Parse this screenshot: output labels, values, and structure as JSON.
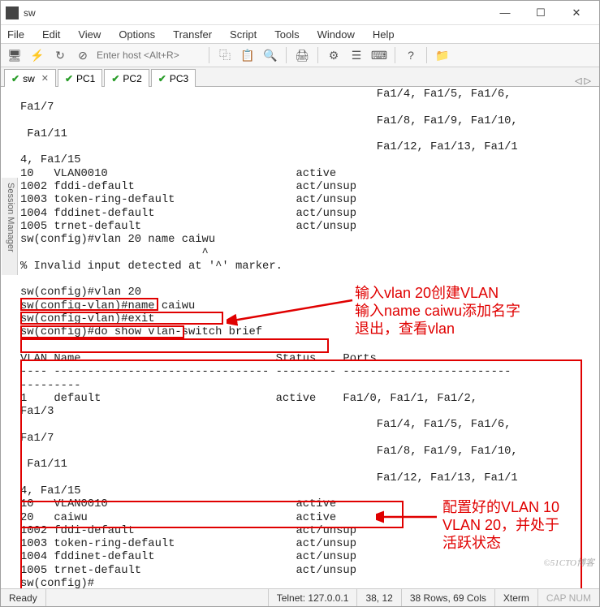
{
  "window": {
    "title": "sw"
  },
  "menu": {
    "file": "File",
    "edit": "Edit",
    "view": "View",
    "options": "Options",
    "transfer": "Transfer",
    "script": "Script",
    "tools": "Tools",
    "window": "Window",
    "help": "Help"
  },
  "toolbar": {
    "host_placeholder": "Enter host <Alt+R>"
  },
  "side_tab": "Session Manager",
  "tabs": {
    "t0": {
      "label": "sw"
    },
    "t1": {
      "label": "PC1"
    },
    "t2": {
      "label": "PC2"
    },
    "t3": {
      "label": "PC3"
    },
    "nav": "◁  ▷"
  },
  "terminal": "                                                     Fa1/4, Fa1/5, Fa1/6,\nFa1/7\n                                                     Fa1/8, Fa1/9, Fa1/10,\n Fa1/11\n                                                     Fa1/12, Fa1/13, Fa1/1\n4, Fa1/15\n10   VLAN0010                            active\n1002 fddi-default                        act/unsup\n1003 token-ring-default                  act/unsup\n1004 fddinet-default                     act/unsup\n1005 trnet-default                       act/unsup\nsw(config)#vlan 20 name caiwu\n                           ^\n% Invalid input detected at '^' marker.\n\nsw(config)#vlan 20\nsw(config-vlan)#name caiwu\nsw(config-vlan)#exit\nsw(config)#do show vlan-switch brief\n\nVLAN Name                             Status    Ports\n---- -------------------------------- --------- -------------------------\n---------\n1    default                          active    Fa1/0, Fa1/1, Fa1/2,\nFa1/3\n                                                     Fa1/4, Fa1/5, Fa1/6,\nFa1/7\n                                                     Fa1/8, Fa1/9, Fa1/10,\n Fa1/11\n                                                     Fa1/12, Fa1/13, Fa1/1\n4, Fa1/15\n10   VLAN0010                            active\n20   caiwu                               active\n1002 fddi-default                        act/unsup\n1003 token-ring-default                  act/unsup\n1004 fddinet-default                     act/unsup\n1005 trnet-default                       act/unsup\nsw(config)#",
  "status": {
    "ready": "Ready",
    "conn": "Telnet: 127.0.0.1",
    "pos": "38, 12",
    "size": "38 Rows, 69 Cols",
    "term": "Xterm",
    "caps": "CAP  NUM"
  },
  "annotations": {
    "note1_l1": "输入vlan 20创建VLAN",
    "note1_l2": "输入name caiwu添加名字",
    "note1_l3": "退出，查看vlan",
    "note2_l1": "配置好的VLAN 10",
    "note2_l2": "VLAN 20，并处于",
    "note2_l3": "活跃状态"
  },
  "watermark": "©51CTO博客"
}
